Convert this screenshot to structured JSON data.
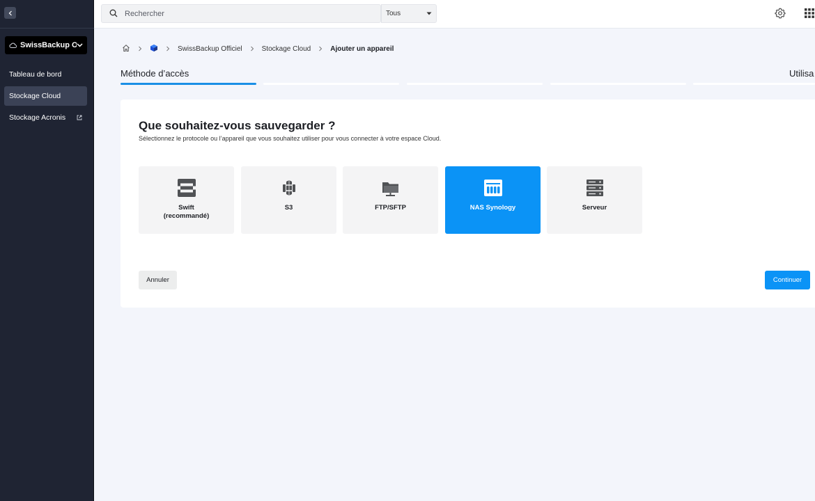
{
  "sidebar": {
    "account": {
      "label": "SwissBackup Of...",
      "icon": "cloud-icon"
    },
    "items": [
      {
        "label": "Tableau de bord",
        "active": false
      },
      {
        "label": "Stockage Cloud",
        "active": true
      },
      {
        "label": "Stockage Acronis",
        "active": false,
        "external": true
      }
    ]
  },
  "topbar": {
    "search_placeholder": "Rechercher",
    "scope": "Tous"
  },
  "breadcrumb": [
    "SwissBackup Officiel",
    "Stockage Cloud",
    "Ajouter un appareil"
  ],
  "steps": [
    {
      "label": "Méthode d’accès",
      "active": true
    },
    {
      "label": "",
      "active": false
    },
    {
      "label": "",
      "active": false
    },
    {
      "label": "",
      "active": false
    },
    {
      "label": "Utilisa",
      "active": false
    }
  ],
  "card": {
    "title": "Que souhaitez-vous sauvegarder ?",
    "subtitle": "Sélectionnez le protocole ou l’appareil que vous souhaitez utiliser pour vous connecter à votre espace Cloud.",
    "options": [
      {
        "label": "Swift\n(recommandé)",
        "icon": "openstack-icon",
        "selected": false
      },
      {
        "label": "S3",
        "icon": "s3-bucket-icon",
        "selected": false
      },
      {
        "label": "FTP/SFTP",
        "icon": "ftp-folder-icon",
        "selected": false
      },
      {
        "label": "NAS Synology",
        "icon": "nas-icon",
        "selected": true
      },
      {
        "label": "Serveur",
        "icon": "server-icon",
        "selected": false
      }
    ],
    "cancel_label": "Annuler",
    "continue_label": "Continuer"
  },
  "colors": {
    "sidebar_bg": "#1f2433",
    "accent": "#0b93f6",
    "page_bg": "#f3f5fb"
  }
}
